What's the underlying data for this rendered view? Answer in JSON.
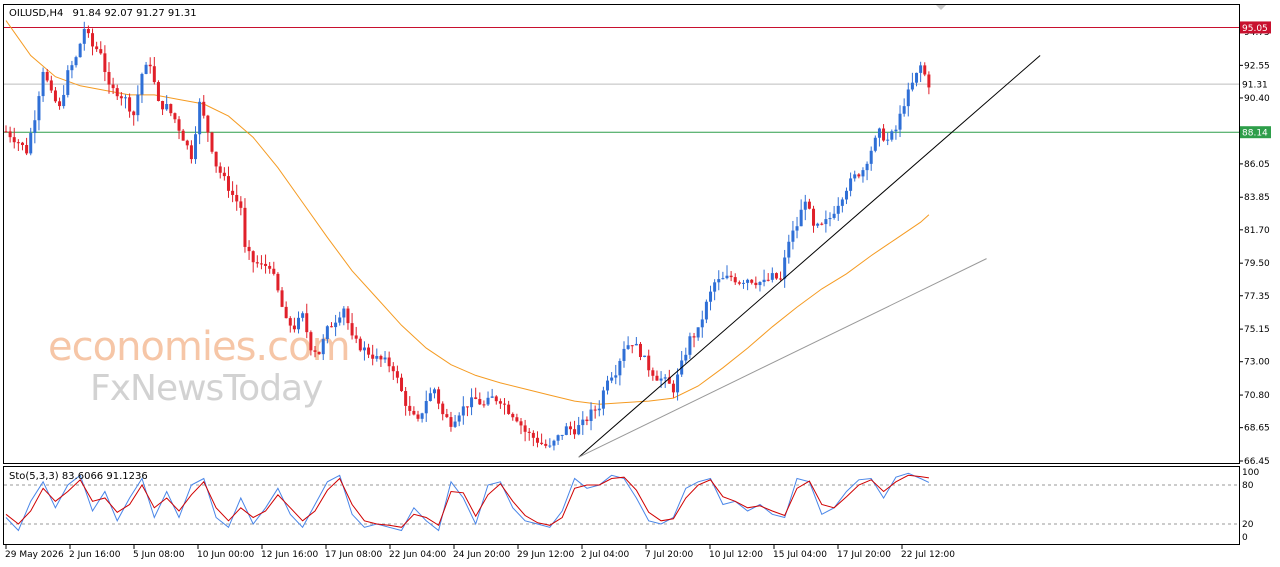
{
  "header": {
    "symbol": "OILUSD,H4",
    "ohlc": "91.84 92.07 91.27 91.31"
  },
  "watermark": {
    "line1": "economies.com",
    "line2": "FxNewsToday"
  },
  "colors": {
    "bull": "#2f6fd6",
    "bear": "#e0202a",
    "ma": "#f59b22",
    "resistance": "#c8102e",
    "support": "#2e9e4a",
    "price_line": "#bdbdbd",
    "stoch_main": "#4a86e8",
    "stoch_signal": "#d00000",
    "trendline": "#000000",
    "trendline2": "#999999"
  },
  "price_tags": {
    "resistance": "95.05",
    "current": "91.31",
    "support": "88.14"
  },
  "indicator": {
    "label": "Sto(5,3,3) 83.6066 91.1236",
    "levels": [
      "100",
      "80",
      "20",
      "0"
    ]
  },
  "chart_data": {
    "type": "candlestick",
    "symbol": "OILUSD",
    "timeframe": "H4",
    "y_ticks": [
      94.75,
      92.55,
      90.4,
      88.2,
      86.05,
      83.85,
      81.7,
      79.5,
      77.35,
      75.15,
      73.0,
      70.8,
      68.65,
      66.45
    ],
    "y_tick_labels": [
      "94.75",
      "92.55",
      "90.40",
      "88.20",
      "86.05",
      "83.85",
      "81.70",
      "79.50",
      "77.35",
      "75.15",
      "73.00",
      "70.80",
      "68.65",
      "66.45"
    ],
    "x_labels": [
      "29 May 2026",
      "2 Jun 16:00",
      "5 Jun 08:00",
      "10 Jun 00:00",
      "12 Jun 16:00",
      "17 Jun 08:00",
      "22 Jun 04:00",
      "24 Jun 20:00",
      "29 Jun 12:00",
      "2 Jul 04:00",
      "7 Jul 20:00",
      "10 Jul 12:00",
      "15 Jul 04:00",
      "17 Jul 20:00",
      "22 Jul 12:00"
    ],
    "horizontal_levels": {
      "resistance": 95.05,
      "support": 88.14,
      "current": 91.31
    },
    "close_path": [
      [
        0,
        88.2
      ],
      [
        3,
        87.5
      ],
      [
        5,
        86.9
      ],
      [
        7,
        89.2
      ],
      [
        9,
        92.3
      ],
      [
        11,
        90.6
      ],
      [
        13,
        89.7
      ],
      [
        15,
        92.0
      ],
      [
        17,
        93.0
      ],
      [
        19,
        95.0
      ],
      [
        21,
        93.8
      ],
      [
        23,
        93.5
      ],
      [
        25,
        91.0
      ],
      [
        27,
        90.8
      ],
      [
        29,
        90.3
      ],
      [
        31,
        89.3
      ],
      [
        33,
        92.0
      ],
      [
        35,
        92.7
      ],
      [
        37,
        90.0
      ],
      [
        39,
        89.8
      ],
      [
        41,
        89.0
      ],
      [
        43,
        87.8
      ],
      [
        45,
        86.6
      ],
      [
        47,
        90.0
      ],
      [
        49,
        88.2
      ],
      [
        51,
        86.0
      ],
      [
        53,
        85.0
      ],
      [
        55,
        84.0
      ],
      [
        57,
        83.2
      ],
      [
        58,
        80.4
      ],
      [
        60,
        79.6
      ],
      [
        62,
        79.3
      ],
      [
        64,
        79.4
      ],
      [
        66,
        77.6
      ],
      [
        68,
        75.6
      ],
      [
        70,
        75.3
      ],
      [
        72,
        76.0
      ],
      [
        74,
        74.0
      ],
      [
        76,
        73.6
      ],
      [
        78,
        75.1
      ],
      [
        80,
        75.8
      ],
      [
        82,
        76.6
      ],
      [
        84,
        74.5
      ],
      [
        86,
        74.0
      ],
      [
        88,
        73.6
      ],
      [
        90,
        73.2
      ],
      [
        92,
        73.0
      ],
      [
        94,
        72.6
      ],
      [
        96,
        71.0
      ],
      [
        98,
        69.6
      ],
      [
        100,
        69.0
      ],
      [
        102,
        70.5
      ],
      [
        104,
        71.2
      ],
      [
        106,
        69.5
      ],
      [
        108,
        69.0
      ],
      [
        110,
        69.7
      ],
      [
        112,
        70.2
      ],
      [
        114,
        70.5
      ],
      [
        116,
        70.1
      ],
      [
        118,
        70.6
      ],
      [
        120,
        70.5
      ],
      [
        122,
        69.8
      ],
      [
        124,
        69.3
      ],
      [
        126,
        68.4
      ],
      [
        128,
        68.0
      ],
      [
        130,
        67.6
      ],
      [
        132,
        67.3
      ],
      [
        134,
        68.0
      ],
      [
        136,
        68.6
      ],
      [
        138,
        68.5
      ],
      [
        140,
        68.9
      ],
      [
        142,
        69.6
      ],
      [
        144,
        70.1
      ],
      [
        146,
        72.0
      ],
      [
        148,
        72.4
      ],
      [
        150,
        74.0
      ],
      [
        152,
        74.3
      ],
      [
        154,
        73.6
      ],
      [
        156,
        72.6
      ],
      [
        158,
        72.0
      ],
      [
        160,
        71.7
      ],
      [
        162,
        71.2
      ],
      [
        164,
        72.8
      ],
      [
        166,
        74.5
      ],
      [
        168,
        75.0
      ],
      [
        170,
        76.8
      ],
      [
        172,
        78.2
      ],
      [
        174,
        78.4
      ],
      [
        176,
        78.6
      ],
      [
        178,
        78.3
      ],
      [
        180,
        78.5
      ],
      [
        182,
        78.3
      ],
      [
        184,
        78.2
      ],
      [
        186,
        78.6
      ],
      [
        188,
        78.4
      ],
      [
        190,
        81.0
      ],
      [
        192,
        82.0
      ],
      [
        194,
        83.8
      ],
      [
        196,
        81.8
      ],
      [
        198,
        81.9
      ],
      [
        200,
        82.5
      ],
      [
        202,
        83.5
      ],
      [
        204,
        84.5
      ],
      [
        206,
        85.2
      ],
      [
        208,
        85.7
      ],
      [
        210,
        87.0
      ],
      [
        212,
        88.1
      ],
      [
        214,
        87.6
      ],
      [
        216,
        88.3
      ],
      [
        218,
        90.1
      ],
      [
        220,
        91.3
      ],
      [
        222,
        92.5
      ],
      [
        224,
        91.31
      ]
    ],
    "moving_average": [
      [
        0,
        95.5
      ],
      [
        6,
        93.2
      ],
      [
        12,
        91.8
      ],
      [
        18,
        91.2
      ],
      [
        24,
        90.9
      ],
      [
        30,
        90.6
      ],
      [
        36,
        90.6
      ],
      [
        42,
        90.3
      ],
      [
        48,
        90.0
      ],
      [
        54,
        89.2
      ],
      [
        60,
        87.8
      ],
      [
        66,
        85.8
      ],
      [
        72,
        83.5
      ],
      [
        78,
        81.2
      ],
      [
        84,
        79.0
      ],
      [
        90,
        77.2
      ],
      [
        96,
        75.4
      ],
      [
        102,
        73.9
      ],
      [
        108,
        72.8
      ],
      [
        114,
        72.1
      ],
      [
        120,
        71.6
      ],
      [
        126,
        71.2
      ],
      [
        132,
        70.8
      ],
      [
        138,
        70.4
      ],
      [
        144,
        70.2
      ],
      [
        150,
        70.3
      ],
      [
        156,
        70.4
      ],
      [
        162,
        70.6
      ],
      [
        168,
        71.4
      ],
      [
        174,
        72.6
      ],
      [
        180,
        73.9
      ],
      [
        186,
        75.3
      ],
      [
        192,
        76.6
      ],
      [
        198,
        77.8
      ],
      [
        204,
        78.8
      ],
      [
        210,
        80.0
      ],
      [
        216,
        81.1
      ],
      [
        222,
        82.2
      ],
      [
        224,
        82.7
      ]
    ],
    "trendline_main": [
      [
        139,
        66.7
      ],
      [
        251,
        93.2
      ]
    ],
    "trendline_secondary": [
      [
        139,
        66.7
      ],
      [
        238,
        79.8
      ]
    ],
    "stochastic": {
      "main": [
        [
          0,
          30
        ],
        [
          3,
          10
        ],
        [
          6,
          55
        ],
        [
          9,
          85
        ],
        [
          12,
          45
        ],
        [
          15,
          80
        ],
        [
          18,
          95
        ],
        [
          21,
          40
        ],
        [
          24,
          70
        ],
        [
          27,
          25
        ],
        [
          30,
          60
        ],
        [
          33,
          90
        ],
        [
          36,
          30
        ],
        [
          39,
          70
        ],
        [
          42,
          30
        ],
        [
          45,
          80
        ],
        [
          48,
          90
        ],
        [
          51,
          30
        ],
        [
          54,
          15
        ],
        [
          57,
          60
        ],
        [
          60,
          20
        ],
        [
          63,
          45
        ],
        [
          66,
          75
        ],
        [
          69,
          35
        ],
        [
          72,
          15
        ],
        [
          75,
          50
        ],
        [
          78,
          85
        ],
        [
          81,
          95
        ],
        [
          84,
          35
        ],
        [
          87,
          15
        ],
        [
          90,
          20
        ],
        [
          93,
          15
        ],
        [
          96,
          10
        ],
        [
          99,
          45
        ],
        [
          102,
          25
        ],
        [
          105,
          10
        ],
        [
          108,
          85
        ],
        [
          111,
          60
        ],
        [
          114,
          20
        ],
        [
          117,
          80
        ],
        [
          120,
          85
        ],
        [
          123,
          45
        ],
        [
          126,
          25
        ],
        [
          129,
          20
        ],
        [
          132,
          15
        ],
        [
          135,
          40
        ],
        [
          138,
          90
        ],
        [
          141,
          75
        ],
        [
          144,
          80
        ],
        [
          147,
          95
        ],
        [
          150,
          90
        ],
        [
          153,
          60
        ],
        [
          156,
          25
        ],
        [
          159,
          20
        ],
        [
          162,
          30
        ],
        [
          165,
          75
        ],
        [
          168,
          85
        ],
        [
          171,
          90
        ],
        [
          174,
          50
        ],
        [
          177,
          55
        ],
        [
          180,
          40
        ],
        [
          183,
          50
        ],
        [
          186,
          35
        ],
        [
          189,
          30
        ],
        [
          192,
          90
        ],
        [
          195,
          85
        ],
        [
          198,
          35
        ],
        [
          201,
          45
        ],
        [
          204,
          70
        ],
        [
          207,
          88
        ],
        [
          210,
          90
        ],
        [
          213,
          60
        ],
        [
          216,
          92
        ],
        [
          219,
          98
        ],
        [
          222,
          90
        ],
        [
          224,
          84
        ]
      ],
      "signal": [
        [
          0,
          35
        ],
        [
          3,
          20
        ],
        [
          6,
          40
        ],
        [
          9,
          75
        ],
        [
          12,
          55
        ],
        [
          15,
          70
        ],
        [
          18,
          88
        ],
        [
          21,
          55
        ],
        [
          24,
          60
        ],
        [
          27,
          38
        ],
        [
          30,
          50
        ],
        [
          33,
          80
        ],
        [
          36,
          45
        ],
        [
          39,
          60
        ],
        [
          42,
          40
        ],
        [
          45,
          65
        ],
        [
          48,
          85
        ],
        [
          51,
          45
        ],
        [
          54,
          25
        ],
        [
          57,
          45
        ],
        [
          60,
          30
        ],
        [
          63,
          40
        ],
        [
          66,
          65
        ],
        [
          69,
          45
        ],
        [
          72,
          25
        ],
        [
          75,
          40
        ],
        [
          78,
          72
        ],
        [
          81,
          90
        ],
        [
          84,
          50
        ],
        [
          87,
          25
        ],
        [
          90,
          20
        ],
        [
          93,
          18
        ],
        [
          96,
          15
        ],
        [
          99,
          35
        ],
        [
          102,
          30
        ],
        [
          105,
          18
        ],
        [
          108,
          70
        ],
        [
          111,
          68
        ],
        [
          114,
          32
        ],
        [
          117,
          65
        ],
        [
          120,
          82
        ],
        [
          123,
          55
        ],
        [
          126,
          33
        ],
        [
          129,
          22
        ],
        [
          132,
          18
        ],
        [
          135,
          30
        ],
        [
          138,
          75
        ],
        [
          141,
          80
        ],
        [
          144,
          80
        ],
        [
          147,
          90
        ],
        [
          150,
          92
        ],
        [
          153,
          72
        ],
        [
          156,
          38
        ],
        [
          159,
          25
        ],
        [
          162,
          28
        ],
        [
          165,
          60
        ],
        [
          168,
          80
        ],
        [
          171,
          88
        ],
        [
          174,
          62
        ],
        [
          177,
          55
        ],
        [
          180,
          45
        ],
        [
          183,
          48
        ],
        [
          186,
          40
        ],
        [
          189,
          33
        ],
        [
          192,
          75
        ],
        [
          195,
          86
        ],
        [
          198,
          50
        ],
        [
          201,
          45
        ],
        [
          204,
          62
        ],
        [
          207,
          80
        ],
        [
          210,
          88
        ],
        [
          213,
          70
        ],
        [
          216,
          85
        ],
        [
          219,
          95
        ],
        [
          222,
          93
        ],
        [
          224,
          91
        ]
      ]
    }
  }
}
